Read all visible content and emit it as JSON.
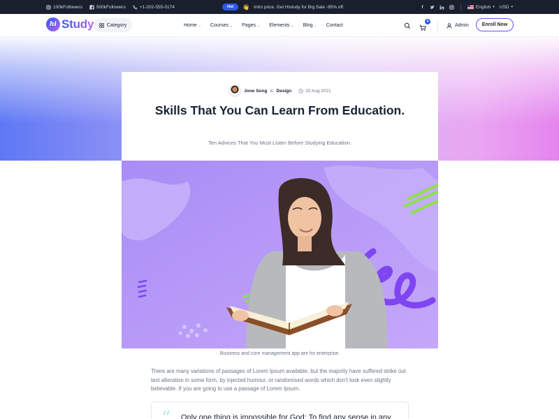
{
  "topbar": {
    "instagram_followers": "100kFollowers",
    "facebook_followers": "500kFollowers",
    "phone": "+1-202-555-0174",
    "hot_badge": "Hot",
    "promo_text": "Intro price. Get Histudy for Big Sale -95% off.",
    "social_icons": [
      "facebook-icon",
      "twitter-icon",
      "linkedin-icon",
      "instagram-icon"
    ],
    "language": "English",
    "currency": "USD"
  },
  "header": {
    "logo_mark": "hi",
    "logo_text": "Study",
    "category_label": "Category",
    "nav": [
      {
        "label": "Home",
        "has_dropdown": true
      },
      {
        "label": "Courses",
        "has_dropdown": true
      },
      {
        "label": "Pages",
        "has_dropdown": true
      },
      {
        "label": "Elements",
        "has_dropdown": true
      },
      {
        "label": "Blog",
        "has_dropdown": true
      },
      {
        "label": "Contact",
        "has_dropdown": false
      }
    ],
    "cart_count": "4",
    "user_label": "Admin",
    "enroll_label": "Enroll Now"
  },
  "article": {
    "author": "Jone Song",
    "in_word": "in",
    "category": "Design",
    "date": "20 Aug 2021",
    "title": "Skills That You Can Learn From Education.",
    "subtitle": "Ten Advices That You Must Listen Before Studying Education.",
    "image_caption": "Business and core management app are for enterprise.",
    "body": "There are many variations of passages of Lorem Ipsum available, but the majority have suffered strike out text alteration in some form, by injected humour, or randomised words which don't look even slightly believable. If you are going to use a passage of Lorem Ipsum.",
    "quote": "Only one thing is impossible for God: To find any sense in any"
  },
  "colors": {
    "primary": "#2f57ef",
    "secondary": "#b966e7",
    "heading": "#192335",
    "body": "#6b7385",
    "topbar_bg": "#1a1f2e",
    "feature_bg": "#b79bf7"
  }
}
